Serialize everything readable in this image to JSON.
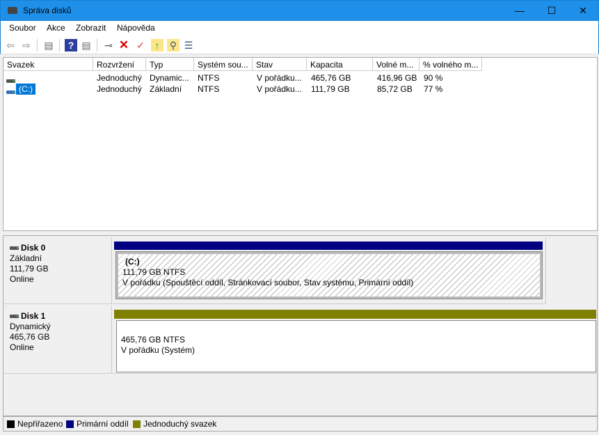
{
  "window": {
    "title": "Správa disků",
    "minimize": "—",
    "maximize": "☐",
    "close": "✕"
  },
  "menu": [
    "Soubor",
    "Akce",
    "Zobrazit",
    "Nápověda"
  ],
  "columns": [
    "Svazek",
    "Rozvržení",
    "Typ",
    "Systém sou...",
    "Stav",
    "Kapacita",
    "Volné m...",
    "% volného m..."
  ],
  "rows": [
    {
      "volume": "",
      "layout": "Jednoduchý",
      "type": "Dynamic...",
      "fs": "NTFS",
      "status": "V pořádku...",
      "capacity": "465,76 GB",
      "free": "416,96 GB",
      "pct": "90 %"
    },
    {
      "volume": "(C:)",
      "layout": "Jednoduchý",
      "type": "Základní",
      "fs": "NTFS",
      "status": "V pořádku...",
      "capacity": "111,79 GB",
      "free": "85,72 GB",
      "pct": "77 %"
    }
  ],
  "disks": [
    {
      "name": "Disk 0",
      "kind": "Základní",
      "size": "111,79 GB",
      "state": "Online",
      "part": {
        "letter": "(C:)",
        "size": "111,79 GB NTFS",
        "status": "V pořádku (Spouštěcí oddíl, Stránkovací soubor, Stav systému, Primární oddíl)"
      },
      "bar_color": "#000080"
    },
    {
      "name": "Disk 1",
      "kind": "Dynamický",
      "size": "465,76 GB",
      "state": "Online",
      "part": {
        "letter": "",
        "size": "465,76 GB NTFS",
        "status": "V pořádku (Systém)"
      },
      "bar_color": "#808000"
    }
  ],
  "legend": [
    {
      "label": "Nepřiřazeno",
      "color": "#000000"
    },
    {
      "label": "Primární oddíl",
      "color": "#000080"
    },
    {
      "label": "Jednoduchý svazek",
      "color": "#808000"
    }
  ]
}
